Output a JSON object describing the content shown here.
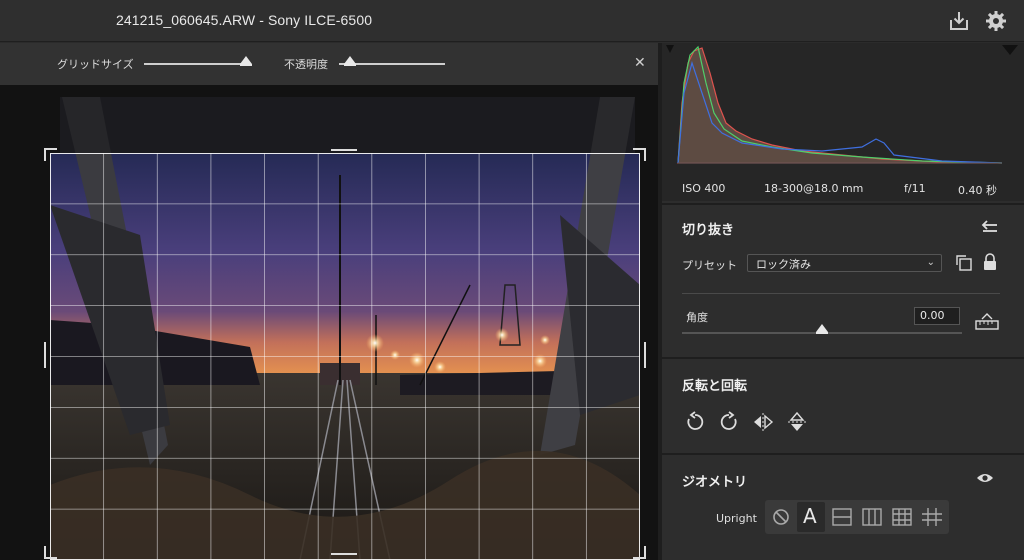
{
  "window": {
    "title": "241215_060645.ARW  -  Sony ILCE-6500",
    "icons": [
      "download-icon",
      "gear-icon"
    ]
  },
  "toolbar": {
    "grid_size_label": "グリッドサイズ",
    "grid_size_value": 0.95,
    "opacity_label": "不透明度",
    "opacity_value": 0.1,
    "close_icon": "close-icon"
  },
  "histogram": {
    "iso": "ISO 400",
    "lens": "18-300@18.0 mm",
    "aperture": "f/11",
    "shutter": "0.40 秒"
  },
  "crop": {
    "title": "切り抜き",
    "preset_label": "プリセット",
    "preset_value": "ロック済み",
    "angle_label": "角度",
    "angle_value": "0.00",
    "angle_slider_value": 0.5
  },
  "transform": {
    "title": "反転と回転",
    "buttons": [
      "rotate-left-icon",
      "rotate-right-icon",
      "flip-horizontal-icon",
      "flip-vertical-icon"
    ]
  },
  "geometry": {
    "title": "ジオメトリ",
    "upright_label": "Upright",
    "upright_options": [
      "off-icon",
      "auto-icon",
      "level-icon",
      "vertical-icon",
      "full-icon",
      "guided-icon"
    ],
    "selected": "auto-icon"
  },
  "colors": {
    "accent": "#e8e8e8",
    "panel_bg": "#2d2d2d",
    "histogram_red": "#e0524e",
    "histogram_green": "#4fcf6a",
    "histogram_blue": "#3f6fe0"
  }
}
